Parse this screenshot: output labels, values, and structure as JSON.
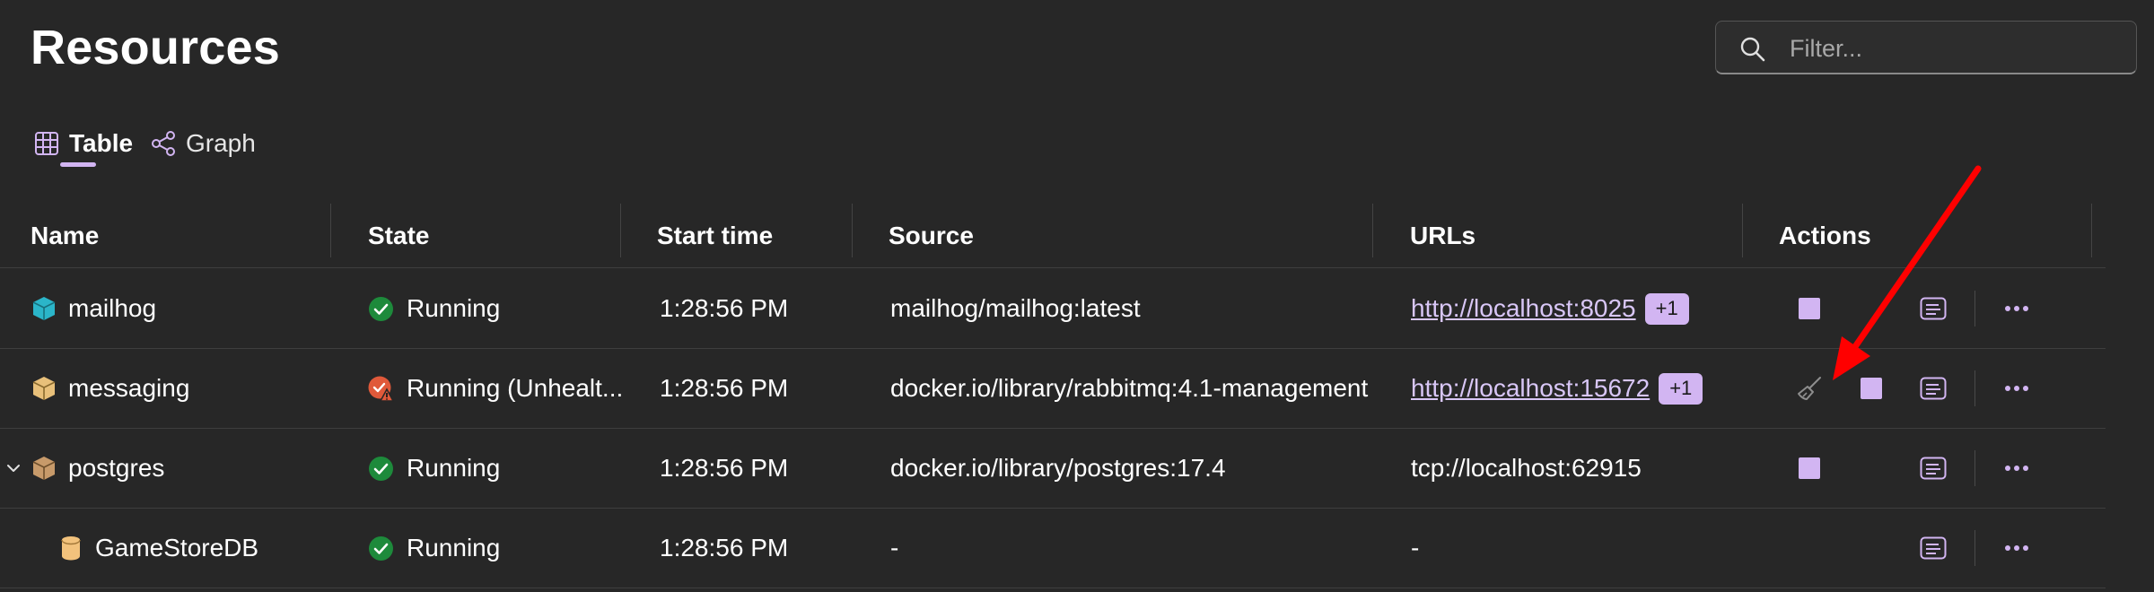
{
  "page": {
    "title": "Resources"
  },
  "search": {
    "placeholder": "Filter...",
    "value": ""
  },
  "tabs": [
    {
      "label": "Table",
      "active": true
    },
    {
      "label": "Graph",
      "active": false
    }
  ],
  "columns": [
    "Name",
    "State",
    "Start time",
    "Source",
    "URLs",
    "Actions"
  ],
  "rows": [
    {
      "name": "mailhog",
      "icon": "container-icon",
      "icon_color": "#2bb5c9",
      "state": "Running",
      "state_icon": "check-circle-icon",
      "start_time": "1:28:56 PM",
      "source": "mailhog/mailhog:latest",
      "url": "http://localhost:8025",
      "url_badge": "+1"
    },
    {
      "name": "messaging",
      "icon": "container-icon",
      "icon_color": "#e8c07a",
      "state": "Running (Unhealt...",
      "state_icon": "warning-circle-icon",
      "start_time": "1:28:56 PM",
      "source": "docker.io/library/rabbitmq:4.1-management",
      "url": "http://localhost:15672",
      "url_badge": "+1"
    },
    {
      "name": "postgres",
      "icon": "container-icon",
      "icon_color": "#c79a6a",
      "state": "Running",
      "state_icon": "check-circle-icon",
      "start_time": "1:28:56 PM",
      "source": "docker.io/library/postgres:17.4",
      "url": "tcp://localhost:62915",
      "url_badge": ""
    },
    {
      "name": "GameStoreDB",
      "icon": "database-icon",
      "icon_color": "#f2c27c",
      "state": "Running",
      "state_icon": "check-circle-icon",
      "start_time": "1:28:56 PM",
      "source": "-",
      "url": "-",
      "url_badge": ""
    }
  ],
  "colors": {
    "background": "#272727",
    "accent": "#d2b5f2",
    "success": "#1d8a3b",
    "warning": "#e0593a",
    "annotation_arrow": "#ff0000"
  }
}
